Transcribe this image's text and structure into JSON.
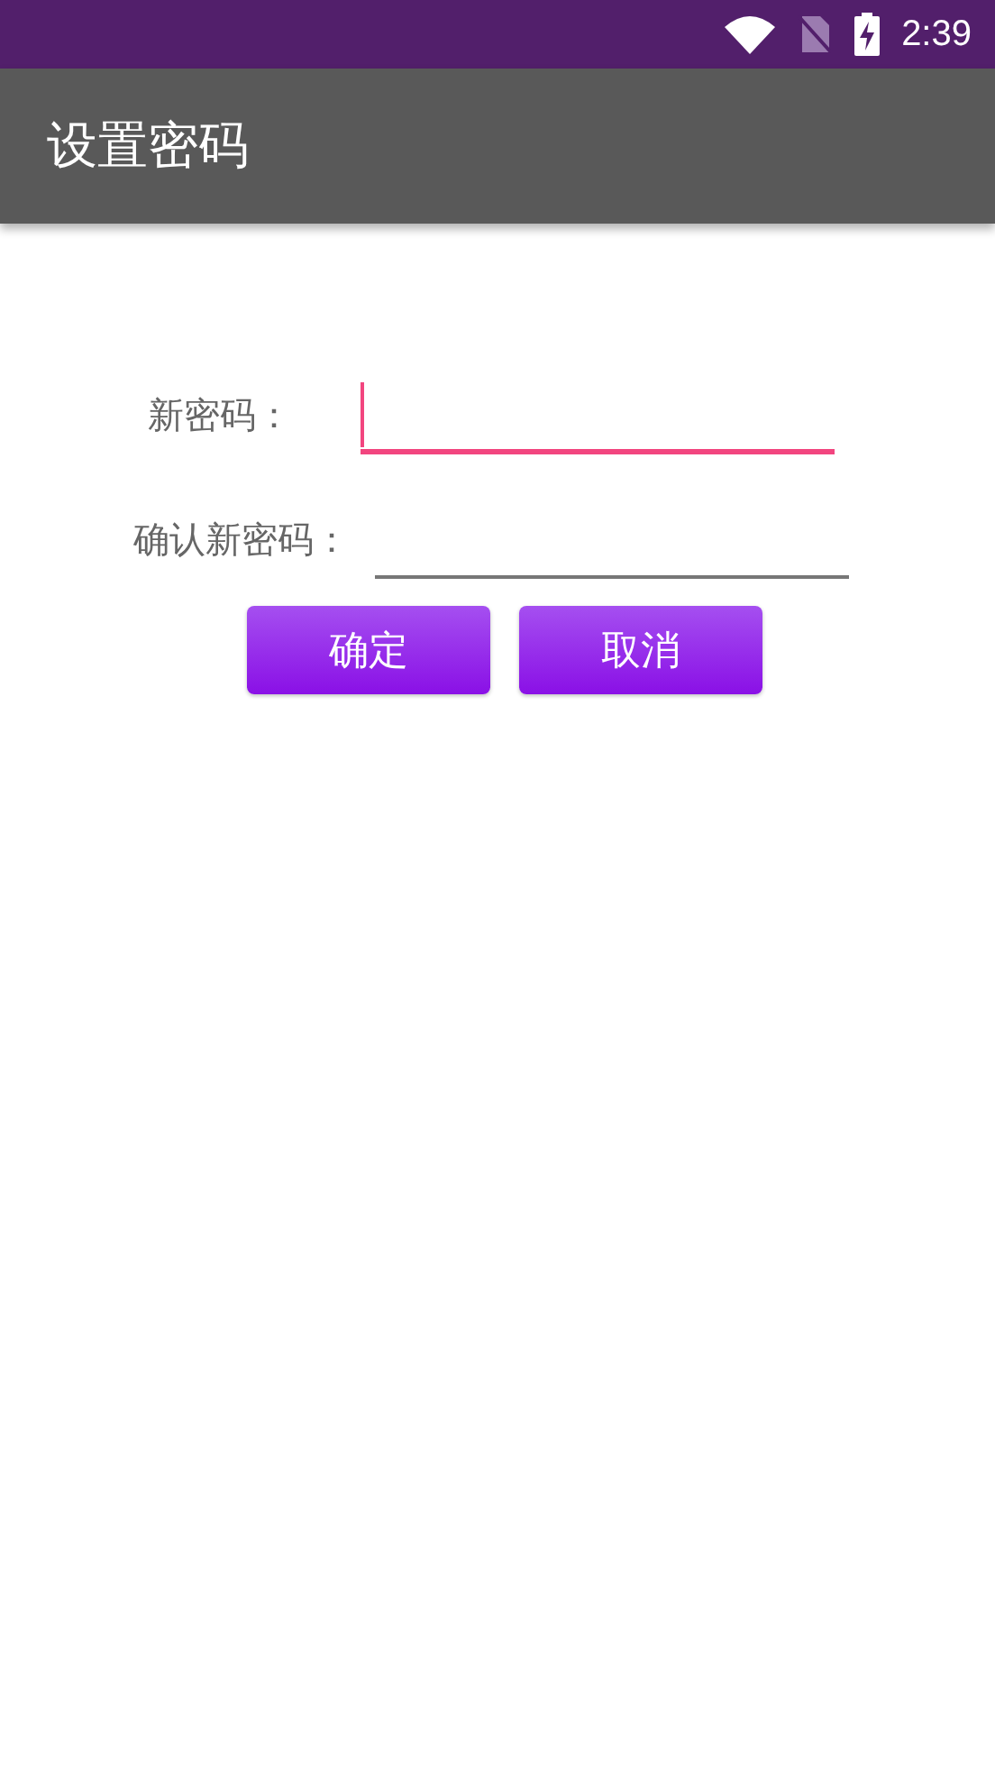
{
  "status_bar": {
    "time": "2:39"
  },
  "app_bar": {
    "title": "设置密码"
  },
  "fields": [
    {
      "label": "新密码：",
      "focused": true
    },
    {
      "label": "确认新密码：",
      "focused": false
    }
  ],
  "buttons": [
    "确定",
    "取消"
  ]
}
